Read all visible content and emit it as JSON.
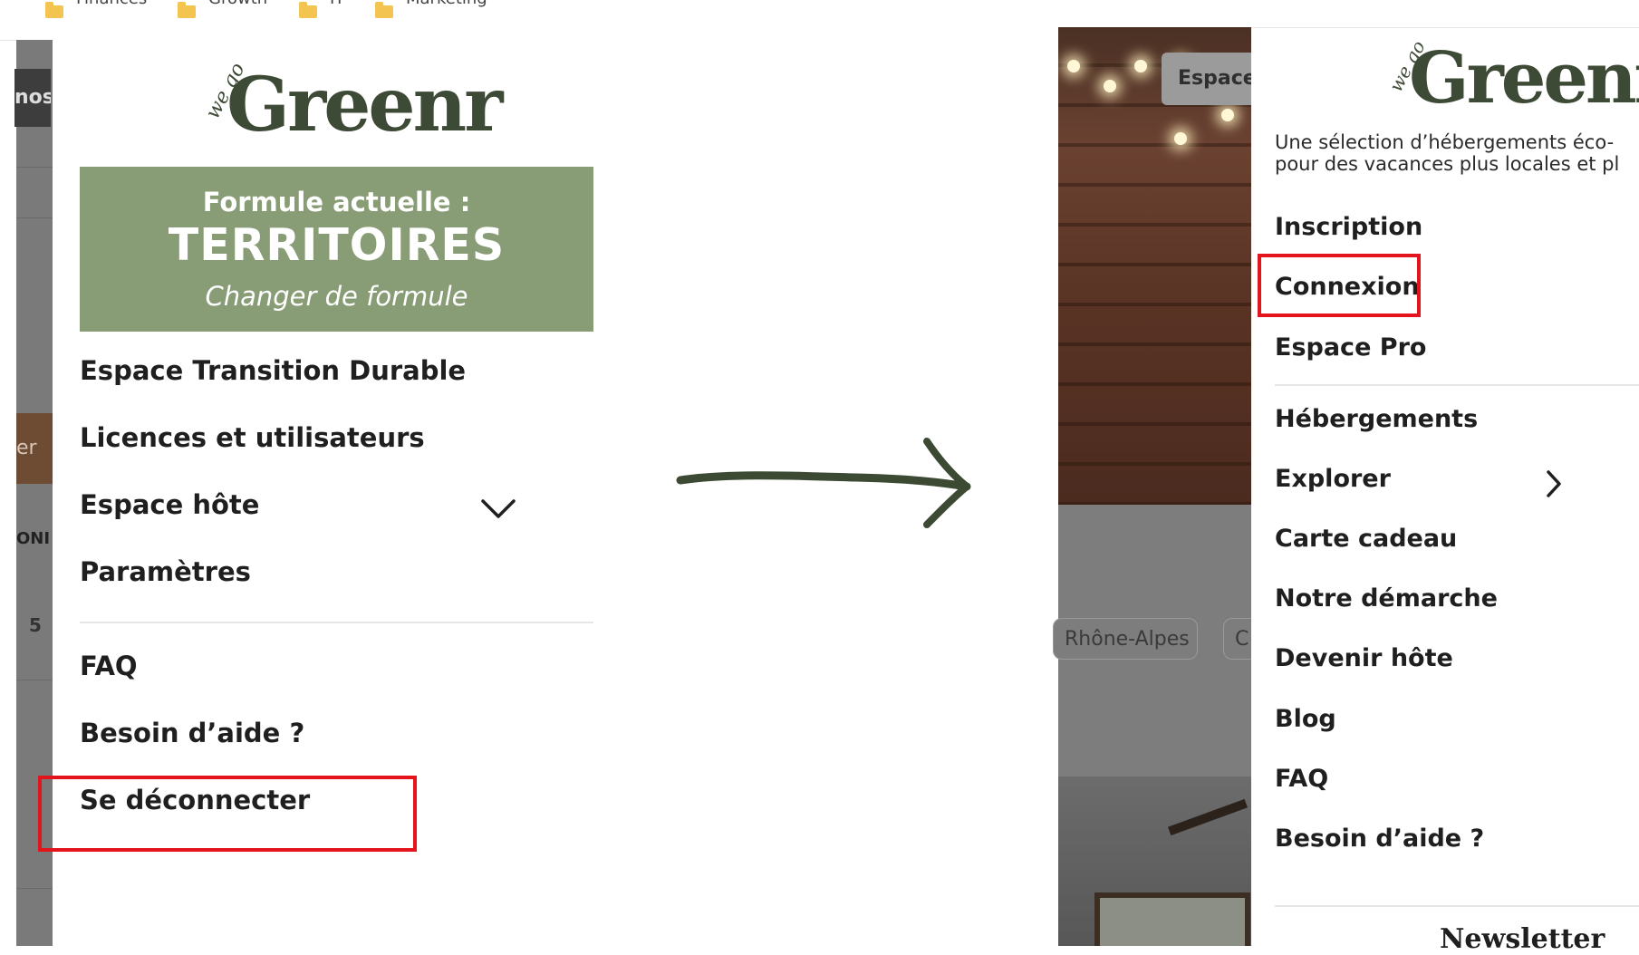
{
  "bookmarks": [
    {
      "label": "Finances",
      "icon": "folder-icon"
    },
    {
      "label": "Growth",
      "icon": "folder-icon"
    },
    {
      "label": "IT",
      "icon": "folder-icon"
    },
    {
      "label": "Marketing",
      "icon": "folder-icon"
    }
  ],
  "background_left": {
    "tab_text": "nos",
    "button_text": "er d",
    "column_text": "ONI",
    "cell_text": "5"
  },
  "brand": {
    "small": "we go",
    "main": "Greenr",
    "color": "#3d4a35"
  },
  "formule": {
    "heading": "Formule actuelle :",
    "plan": "TERRITOIRES",
    "change_link": "Changer de formule",
    "bg_color": "#889d76"
  },
  "left_menu": {
    "items": [
      "Espace Transition Durable",
      "Licences et utilisateurs",
      "Espace hôte",
      "Paramètres",
      "FAQ",
      "Besoin d’aide ?",
      "Se déconnecter"
    ],
    "expand_icon": "chevron-down-icon"
  },
  "arrow": {
    "icon": "arrow-right-icon",
    "color": "#3c4a34"
  },
  "background_right": {
    "espace_button": "Espace",
    "chip_1": "Rhône-Alpes",
    "chip_2": "C"
  },
  "right_menu": {
    "tagline_line1": "Une sélection d’hébergements éco-",
    "tagline_line2": "pour des vacances plus locales et pl",
    "items": [
      "Inscription",
      "Connexion",
      "Espace Pro",
      "Hébergements",
      "Explorer",
      "Carte cadeau",
      "Notre démarche",
      "Devenir hôte",
      "Blog",
      "FAQ",
      "Besoin d’aide ?"
    ],
    "explorer_icon": "chevron-right-icon",
    "newsletter": "Newsletter"
  },
  "highlight_color": "#e3141b"
}
